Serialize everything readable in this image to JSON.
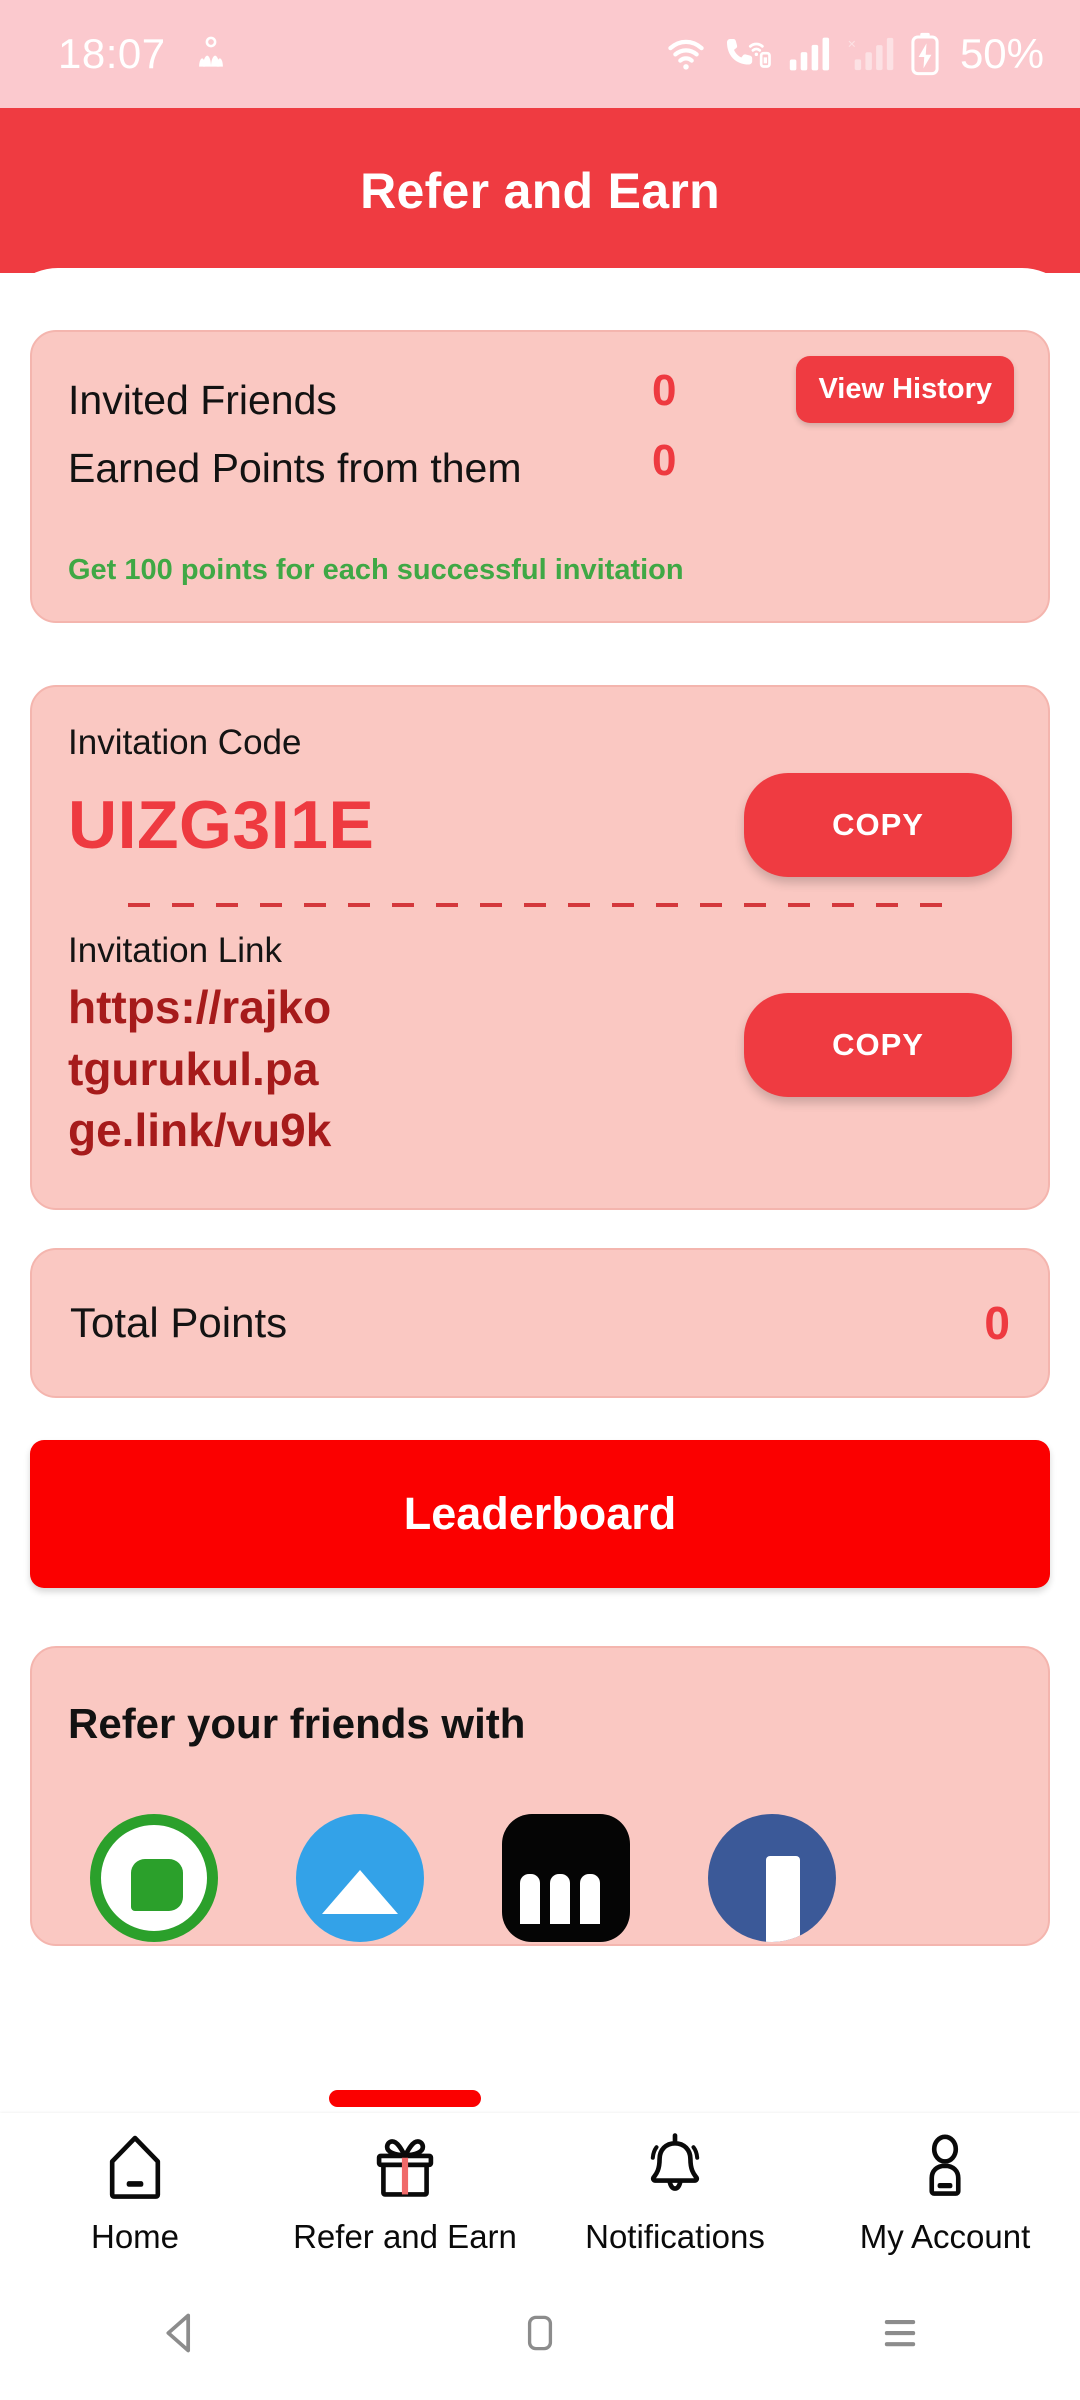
{
  "status_bar": {
    "time": "18:07",
    "battery_percent": "50%",
    "icons": [
      "app-notification-icon",
      "wifi-icon",
      "vowifi-call-icon",
      "signal-bars-icon",
      "signal-disabled-icon",
      "battery-charging-icon"
    ],
    "background_color": "#FBC9CE",
    "foreground_color": "#FFFFFF"
  },
  "header": {
    "title": "Refer and Earn",
    "background_color": "#EF3B41",
    "text_color": "#FFFFFF"
  },
  "stats_card": {
    "rows": [
      {
        "label": "Invited  Friends",
        "value": "0"
      },
      {
        "label": "Earned  Points from them",
        "value": "0"
      }
    ],
    "view_history_label": "View History",
    "note": "Get 100 points for each successful invitation",
    "note_color": "#3FA845",
    "value_color": "#EE3A40",
    "background_color": "#FAC8C2"
  },
  "invitation_card": {
    "code_label": "Invitation Code",
    "code_value": "UIZG3I1E",
    "code_copy_label": "COPY",
    "link_label": "Invitation Link",
    "link_lines": [
      "https://rajko",
      "tgurukul.pa",
      "ge.link/vu9k"
    ],
    "link_full": "https://rajkotgurukul.page.link/vu9k",
    "link_copy_label": "COPY",
    "code_color": "#EE3A40",
    "link_color": "#A61B1B"
  },
  "total_points_card": {
    "label": "Total Points",
    "value": "0"
  },
  "leaderboard_button": {
    "label": "Leaderboard",
    "background_color": "#FB0000",
    "text_color": "#FFFFFF"
  },
  "refer_with": {
    "title": "Refer your friends with",
    "channels": [
      {
        "name": "whatsapp-icon",
        "color": "#2BA02B"
      },
      {
        "name": "telegram-icon",
        "color": "#33A2E8"
      },
      {
        "name": "blackbox-share-icon",
        "color": "#050505"
      },
      {
        "name": "facebook-icon",
        "color": "#3B5998"
      }
    ]
  },
  "bottom_nav": {
    "active_index": 1,
    "active_indicator_color": "#FB0000",
    "items": [
      {
        "label": "Home",
        "icon": "home-icon"
      },
      {
        "label": "Refer and Earn",
        "icon": "gift-icon"
      },
      {
        "label": "Notifications",
        "icon": "bell-icon"
      },
      {
        "label": "My Account",
        "icon": "person-icon"
      }
    ]
  },
  "android_nav": {
    "items": [
      {
        "name": "back-icon"
      },
      {
        "name": "home-square-icon"
      },
      {
        "name": "recents-menu-icon"
      }
    ],
    "color": "#8C8C8C"
  }
}
